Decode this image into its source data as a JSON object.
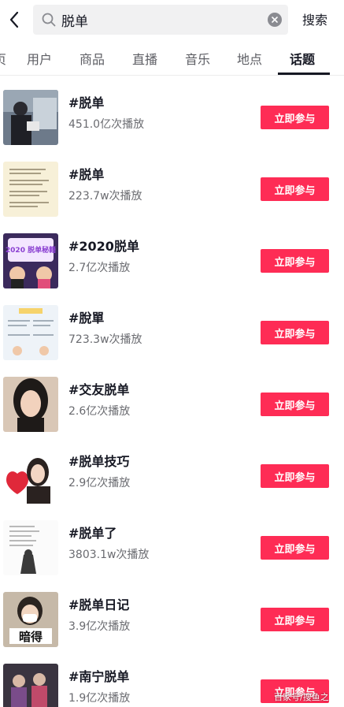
{
  "header": {
    "search_value": "脱单",
    "search_button": "搜索",
    "icons": {
      "back": "chevron-left-icon",
      "search": "search-icon",
      "clear": "clear-icon"
    }
  },
  "tabs": [
    {
      "label": "页",
      "active": false
    },
    {
      "label": "用户",
      "active": false
    },
    {
      "label": "商品",
      "active": false
    },
    {
      "label": "直播",
      "active": false
    },
    {
      "label": "音乐",
      "active": false
    },
    {
      "label": "地点",
      "active": false
    },
    {
      "label": "话题",
      "active": true
    }
  ],
  "topics": [
    {
      "title": "#脱单",
      "plays": "451.0亿次播放",
      "action": "立即参与"
    },
    {
      "title": "#脱单",
      "plays": "223.7w次播放",
      "action": "立即参与"
    },
    {
      "title": "#2020脱单",
      "plays": "2.7亿次播放",
      "action": "立即参与",
      "thumb_text": "2020 脱单秘籍"
    },
    {
      "title": "#脫單",
      "plays": "723.3w次播放",
      "action": "立即参与"
    },
    {
      "title": "#交友脱单",
      "plays": "2.6亿次播放",
      "action": "立即参与"
    },
    {
      "title": "#脱单技巧",
      "plays": "2.9亿次播放",
      "action": "立即参与"
    },
    {
      "title": "#脱单了",
      "plays": "3803.1w次播放",
      "action": "立即参与"
    },
    {
      "title": "#脱单日记",
      "plays": "3.9亿次播放",
      "action": "立即参与",
      "thumb_text": "暗得"
    },
    {
      "title": "#南宁脱单",
      "plays": "1.9亿次播放",
      "action": "立即参与"
    }
  ],
  "watermark": "百家号/搜鱼之",
  "colors": {
    "accent": "#fe2c55",
    "text": "#161823",
    "secondary": "#6a6b70"
  }
}
